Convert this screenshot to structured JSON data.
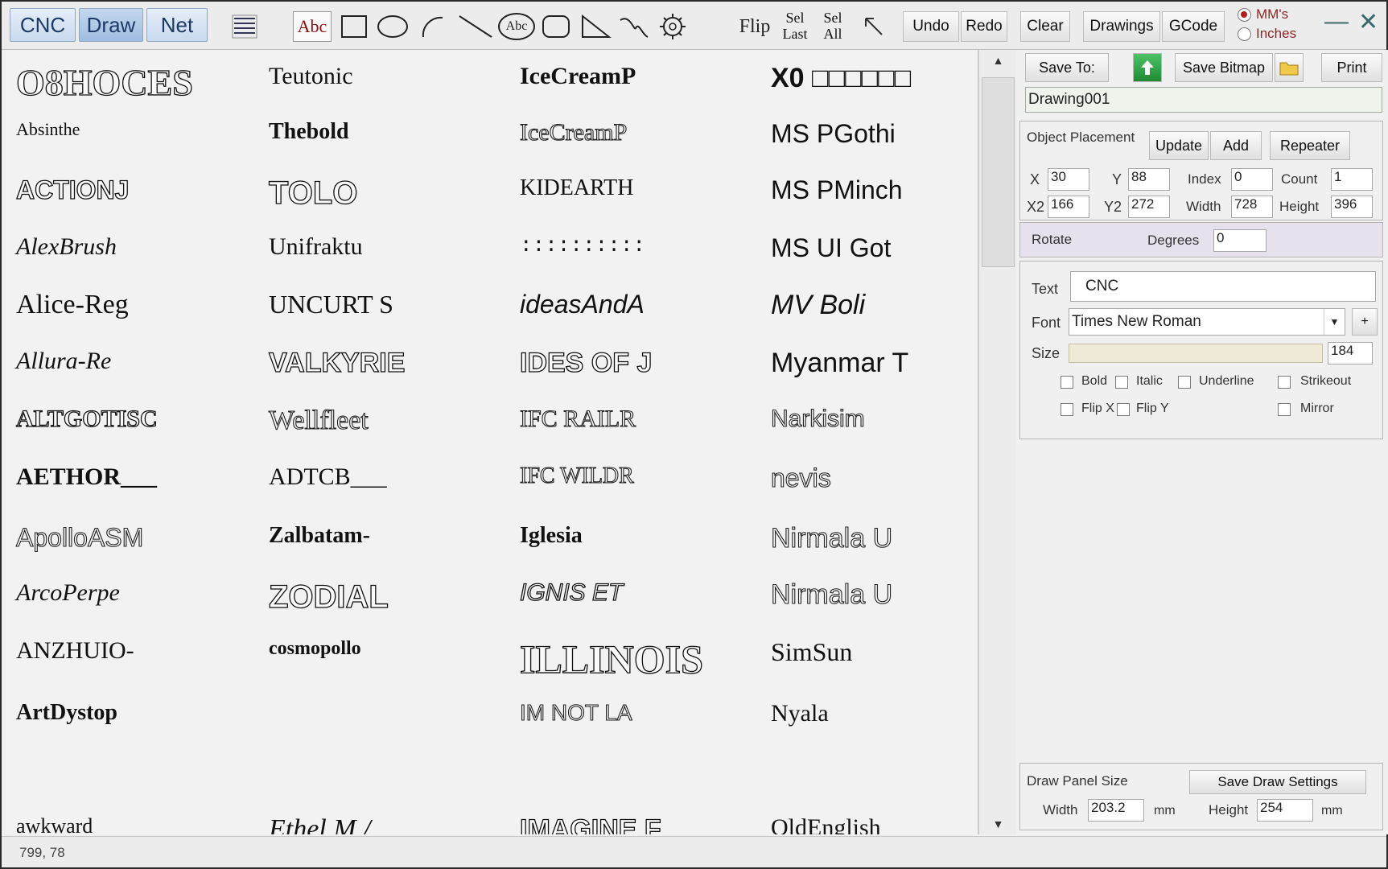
{
  "mode_tabs": [
    "CNC",
    "Draw",
    "Net"
  ],
  "toolbar": {
    "flip": "Flip",
    "sel_last_1": "Sel",
    "sel_last_2": "Last",
    "sel_all_1": "Sel",
    "sel_all_2": "All",
    "undo": "Undo",
    "redo": "Redo",
    "clear": "Clear",
    "drawings": "Drawings",
    "gcode": "GCode",
    "tool_text": "Abc",
    "tool_text_circle": "Abc",
    "units": {
      "mms": "MM's",
      "inches": "Inches",
      "selected": "mms"
    }
  },
  "font_grid": [
    {
      "label": "O8HOCES",
      "style": "outline",
      "family": "serif",
      "size": 46
    },
    {
      "label": "Teutonic",
      "style": "serif",
      "family": "serif",
      "size": 30
    },
    {
      "label": "IceCreamP",
      "style": "serif-bold",
      "family": "serif",
      "size": 30
    },
    {
      "label": "X0 □□□□□□",
      "style": "sans-bold",
      "family": "sans",
      "size": 34
    },
    {
      "label": "Absinthe",
      "style": "serif",
      "family": "serif",
      "size": 22
    },
    {
      "label": "Thebold",
      "style": "serif-bold",
      "family": "serif",
      "size": 28
    },
    {
      "label": "IceCreamP",
      "style": "lite",
      "family": "serif",
      "size": 30
    },
    {
      "label": "MS PGothi",
      "style": "sans",
      "family": "sans",
      "size": 32
    },
    {
      "label": "ACTIONJ",
      "style": "outline",
      "family": "sans",
      "size": 32
    },
    {
      "label": "TOLO",
      "style": "outline",
      "family": "sans",
      "size": 40
    },
    {
      "label": "KIDEARTH",
      "style": "serif",
      "family": "serif",
      "size": 28
    },
    {
      "label": "MS PMinch",
      "style": "sans",
      "family": "sans",
      "size": 32
    },
    {
      "label": "AlexBrush",
      "style": "script",
      "family": "serif",
      "size": 30
    },
    {
      "label": "Unifraktu",
      "style": "serif",
      "family": "serif",
      "size": 30
    },
    {
      "label": "::::::::::",
      "style": "mono",
      "family": "mono",
      "size": 26
    },
    {
      "label": "MS UI Got",
      "style": "sans",
      "family": "sans",
      "size": 32
    },
    {
      "label": "Alice-Reg",
      "style": "serif",
      "family": "serif",
      "size": 34
    },
    {
      "label": "UNCURT S",
      "style": "serif",
      "family": "serif",
      "size": 32
    },
    {
      "label": "ideasAndA",
      "style": "script",
      "family": "sans",
      "size": 32
    },
    {
      "label": "MV Boli",
      "style": "italic",
      "family": "sans",
      "size": 34
    },
    {
      "label": "Allura-Re",
      "style": "script",
      "family": "serif",
      "size": 30
    },
    {
      "label": "VALKYRIE",
      "style": "outline",
      "family": "sans",
      "size": 34
    },
    {
      "label": "IDES OF J",
      "style": "outline",
      "family": "sans",
      "size": 34
    },
    {
      "label": "Myanmar T",
      "style": "sans",
      "family": "sans",
      "size": 34
    },
    {
      "label": "ALTGOTISC",
      "style": "outline",
      "family": "serif",
      "size": 30
    },
    {
      "label": "Wellfleet",
      "style": "lite",
      "family": "serif",
      "size": 34
    },
    {
      "label": "IFC RAILR",
      "style": "lite",
      "family": "serif",
      "size": 30
    },
    {
      "label": "Narkisim",
      "style": "lite",
      "family": "sans",
      "size": 30
    },
    {
      "label": "AETHOR___",
      "style": "serif-bold",
      "family": "serif",
      "size": 30
    },
    {
      "label": "ADTCB___",
      "style": "serif",
      "family": "serif",
      "size": 30
    },
    {
      "label": "IFC WILDR",
      "style": "lite",
      "family": "serif",
      "size": 28
    },
    {
      "label": "nevis",
      "style": "lite",
      "family": "sans",
      "size": 32
    },
    {
      "label": "ApolloASM",
      "style": "lite",
      "family": "sans",
      "size": 32
    },
    {
      "label": "Zalbatam-",
      "style": "serif-bold",
      "family": "serif",
      "size": 28
    },
    {
      "label": "Iglesia",
      "style": "serif-bold",
      "family": "serif",
      "size": 28
    },
    {
      "label": "Nirmala U",
      "style": "lite",
      "family": "sans",
      "size": 34
    },
    {
      "label": "ArcoPerpe",
      "style": "script",
      "family": "serif",
      "size": 30
    },
    {
      "label": "ZODIAL",
      "style": "outline",
      "family": "sans",
      "size": 40
    },
    {
      "label": "IGNIS ET",
      "style": "italic-outline",
      "family": "sans",
      "size": 30
    },
    {
      "label": "Nirmala U",
      "style": "lite",
      "family": "sans",
      "size": 34
    },
    {
      "label": "ANZHUIO-",
      "style": "serif",
      "family": "serif",
      "size": 30
    },
    {
      "label": "cosmopollo",
      "style": "serif-bold",
      "family": "serif",
      "size": 24
    },
    {
      "label": "ILLINOIS",
      "style": "outline",
      "family": "serif",
      "size": 50
    },
    {
      "label": "SimSun",
      "style": "serif",
      "family": "serif",
      "size": 32
    },
    {
      "label": "ArtDystop",
      "style": "serif-bold",
      "family": "serif",
      "size": 28
    },
    {
      "label": "",
      "style": "serif",
      "family": "serif",
      "size": 28
    },
    {
      "label": "IM NOT LA",
      "style": "lite",
      "family": "sans",
      "size": 28
    },
    {
      "label": "Nyala",
      "style": "serif",
      "family": "serif",
      "size": 30
    }
  ],
  "font_grid_partial": [
    {
      "label": "awkward",
      "style": "serif",
      "family": "serif",
      "size": 26
    },
    {
      "label": "Ethel M /",
      "style": "script",
      "family": "serif",
      "size": 34
    },
    {
      "label": "IMAGINE F",
      "style": "outline",
      "family": "sans",
      "size": 34
    },
    {
      "label": "OldEnglish",
      "style": "serif",
      "family": "serif",
      "size": 30
    }
  ],
  "panel": {
    "save_to": "Save To:",
    "save_bitmap": "Save Bitmap",
    "print": "Print",
    "drawing_name": "Drawing001",
    "object_placement": "Object Placement",
    "update": "Update",
    "add": "Add",
    "repeater": "Repeater",
    "fields": {
      "x_label": "X",
      "x": "30",
      "y_label": "Y",
      "y": "88",
      "index_label": "Index",
      "index": "0",
      "count_label": "Count",
      "count": "1",
      "x2_label": "X2",
      "x2": "166",
      "y2_label": "Y2",
      "y2": "272",
      "width_label": "Width",
      "width": "728",
      "height_label": "Height",
      "height": "396"
    },
    "rotate": "Rotate",
    "degrees_label": "Degrees",
    "degrees": "0",
    "text_label": "Text",
    "text_value": "CNC",
    "font_label": "Font",
    "font_value": "Times New Roman",
    "font_add": "+",
    "size_label": "Size",
    "size_value": "184",
    "checks": {
      "bold": "Bold",
      "italic": "Italic",
      "underline": "Underline",
      "strikeout": "Strikeout",
      "flip_x": "Flip X",
      "flip_y": "Flip Y",
      "mirror": "Mirror"
    },
    "draw_panel_size": "Draw Panel Size",
    "save_draw_settings": "Save Draw Settings",
    "dp_width_label": "Width",
    "dp_width": "203.2",
    "dp_width_unit": "mm",
    "dp_height_label": "Height",
    "dp_height": "254",
    "dp_height_unit": "mm"
  },
  "status": {
    "coords": "799, 78"
  },
  "colors": {
    "accent": "#1c3a66",
    "unit_red": "#8c2626",
    "rotate_bg": "#e6e1ec",
    "gcode_btn_green": "#2a9d3a"
  }
}
